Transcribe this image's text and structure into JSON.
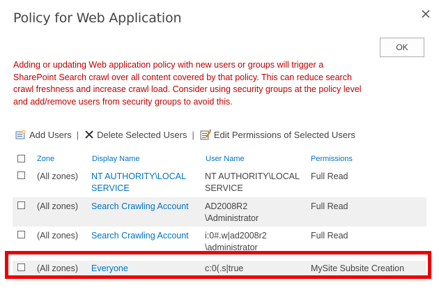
{
  "dialog": {
    "title": "Policy for Web Application",
    "ok_label": "OK"
  },
  "warning": {
    "lines": [
      "Adding or updating Web application policy with new users or groups will trigger a",
      "SharePoint Search crawl over all content covered by that policy. This can reduce search",
      "crawl freshness and increase crawl load. Consider using security groups at the policy level",
      "and add/remove users from security groups to avoid this."
    ]
  },
  "toolbar": {
    "add_users": "Add Users",
    "sep": "|",
    "delete_users": "Delete Selected Users",
    "edit_permissions": "Edit Permissions of Selected Users"
  },
  "grid": {
    "headers": {
      "zone": "Zone",
      "display_name": "Display Name",
      "user_name": "User Name",
      "permissions": "Permissions"
    },
    "rows": [
      {
        "zone": "(All zones)",
        "display_line1": "NT AUTHORITY\\LOCAL",
        "display_line2": "SERVICE",
        "user_line1": "NT AUTHORITY\\LOCAL",
        "user_line2": "SERVICE",
        "permissions": "Full Read"
      },
      {
        "zone": "(All zones)",
        "display_line1": "Search Crawling Account",
        "display_line2": "",
        "user_line1": "AD2008R2",
        "user_line2": "\\Administrator",
        "permissions": "Full Read"
      },
      {
        "zone": "(All zones)",
        "display_line1": "Search Crawling Account",
        "display_line2": "",
        "user_line1": "i:0#.w|ad2008r2",
        "user_line2": "\\administrator",
        "permissions": "Full Read"
      },
      {
        "zone": "(All zones)",
        "display_line1": "Everyone",
        "display_line2": "",
        "user_line1": "c:0(.s|true",
        "user_line2": "",
        "permissions": "MySite Subsite Creation"
      }
    ]
  },
  "colors": {
    "link": "#0072c6",
    "warning": "#bf0000",
    "highlight_border": "#ee0000",
    "alt_row": "#f0f0f0"
  },
  "icons": [
    "close-icon",
    "add-users-icon",
    "delete-icon",
    "edit-permissions-icon"
  ]
}
